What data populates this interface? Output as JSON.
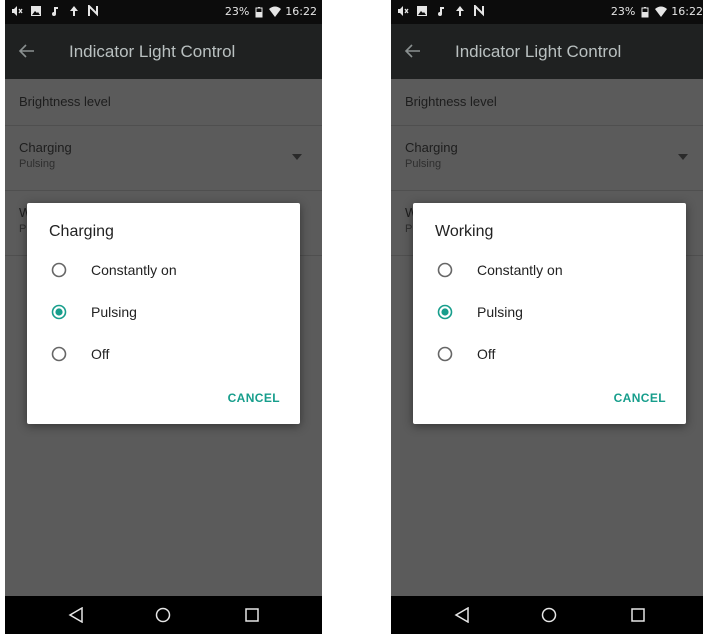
{
  "colors": {
    "accent": "#179e8c",
    "app_bar": "#1f2121",
    "status_bar": "#0c0c0c",
    "scrim_background": "#5b5b5b"
  },
  "left_screen": {
    "status_bar": {
      "battery": "23%",
      "time": "16:22"
    },
    "app_bar": {
      "title": "Indicator Light Control",
      "back_icon": "arrow-left-icon"
    },
    "settings": {
      "brightness": {
        "title": "Brightness level"
      },
      "charging": {
        "title": "Charging",
        "value": "Pulsing"
      },
      "working": {
        "title": "W",
        "value": "P"
      }
    },
    "dialog": {
      "title": "Charging",
      "options": [
        {
          "label": "Constantly on",
          "selected": false
        },
        {
          "label": "Pulsing",
          "selected": true
        },
        {
          "label": "Off",
          "selected": false
        }
      ],
      "cancel_label": "CANCEL"
    }
  },
  "right_screen": {
    "status_bar": {
      "battery": "23%",
      "time": "16:22"
    },
    "app_bar": {
      "title": "Indicator Light Control",
      "back_icon": "arrow-left-icon"
    },
    "settings": {
      "brightness": {
        "title": "Brightness level"
      },
      "charging": {
        "title": "Charging",
        "value": "Pulsing"
      },
      "working": {
        "title": "W",
        "value": "P"
      }
    },
    "dialog": {
      "title": "Working",
      "options": [
        {
          "label": "Constantly on",
          "selected": false
        },
        {
          "label": "Pulsing",
          "selected": true
        },
        {
          "label": "Off",
          "selected": false
        }
      ],
      "cancel_label": "CANCEL"
    }
  }
}
